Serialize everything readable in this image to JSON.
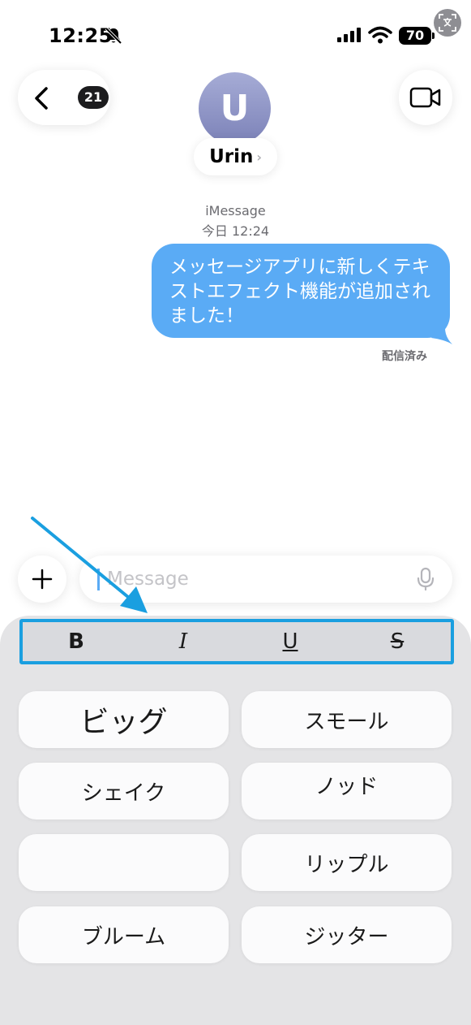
{
  "status_bar": {
    "time": "12:25",
    "battery": "70",
    "icons": [
      "bell-slash-icon",
      "cellular-signal-icon",
      "wifi-icon",
      "battery-icon",
      "translate-icon"
    ]
  },
  "header": {
    "back_badge": "21",
    "avatar_initial": "U",
    "contact_name": "Urin",
    "contact_chevron": "›",
    "icons": [
      "chevron-left-icon",
      "video-camera-icon"
    ]
  },
  "conversation": {
    "service": "iMessage",
    "timestamp": "今日 12:24",
    "messages": [
      {
        "text": "メッセージアプリに新しくテキストエフェクト機能が追加されました！",
        "sender": "me"
      }
    ],
    "delivery_status": "配信済み"
  },
  "composer": {
    "placeholder": "Message",
    "icons": [
      "plus-icon",
      "microphone-icon"
    ]
  },
  "format_bar": {
    "bold": "B",
    "italic": "I",
    "underline": "U",
    "strikethrough": "S"
  },
  "effects": [
    {
      "label": "ビッグ"
    },
    {
      "label": "スモール"
    },
    {
      "label": "シェイク"
    },
    {
      "label": "ノッド"
    },
    {
      "label": ""
    },
    {
      "label": "リップル"
    },
    {
      "label": "ブルーム"
    },
    {
      "label": "ジッター"
    }
  ],
  "colors": {
    "bubble": "#5aabf5",
    "highlight": "#1a9fe0",
    "panel": "#e4e4e6"
  }
}
